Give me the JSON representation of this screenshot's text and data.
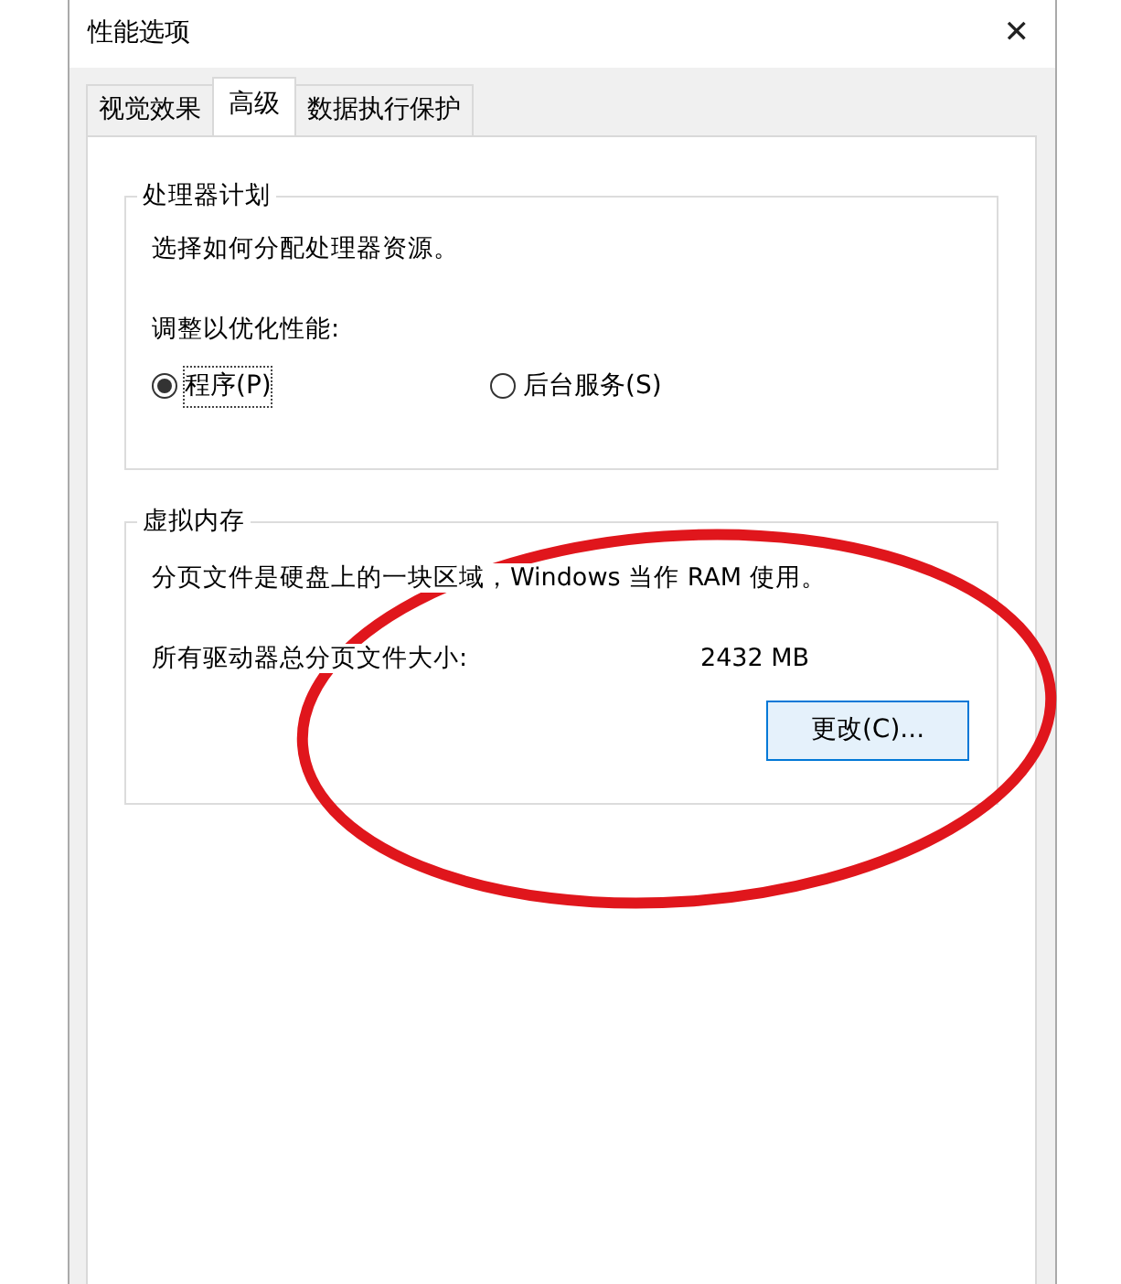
{
  "window": {
    "title": "性能选项",
    "close": "✕"
  },
  "tabs": [
    {
      "label": "视觉效果",
      "selected": false
    },
    {
      "label": "高级",
      "selected": true
    },
    {
      "label": "数据执行保护",
      "selected": false
    }
  ],
  "processor_group": {
    "title": "处理器计划",
    "description": "选择如何分配处理器资源。",
    "adjust_label": "调整以优化性能:",
    "options": [
      {
        "label": "程序(P)",
        "selected": true
      },
      {
        "label": "后台服务(S)",
        "selected": false
      }
    ]
  },
  "virtual_memory_group": {
    "title": "虚拟内存",
    "description": "分页文件是硬盘上的一块区域，Windows 当作 RAM 使用。",
    "size_label": "所有驱动器总分页文件大小:",
    "size_value": "2432 MB",
    "change_button": "更改(C)..."
  },
  "annotation": {
    "kind": "ellipse",
    "color": "#e0161c"
  }
}
